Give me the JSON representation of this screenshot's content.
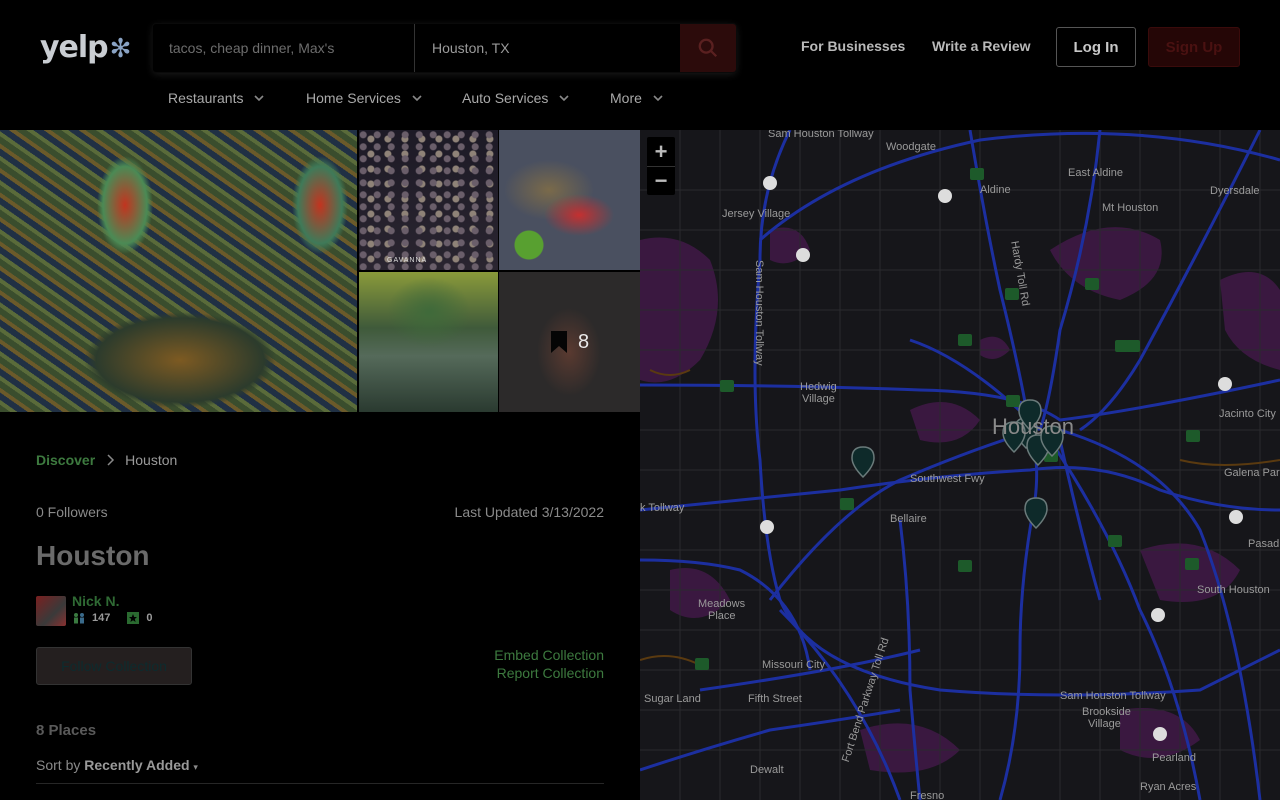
{
  "header": {
    "logo": "yelp",
    "search_find_placeholder": "tacos, cheap dinner, Max's",
    "search_near_value": "Houston, TX",
    "for_businesses": "For Businesses",
    "write_review": "Write a Review",
    "login": "Log In",
    "signup": "Sign Up",
    "nav": [
      {
        "label": "Restaurants"
      },
      {
        "label": "Home Services"
      },
      {
        "label": "Auto Services"
      },
      {
        "label": "More"
      }
    ]
  },
  "photos": {
    "crowd_caption": "GAVANNA",
    "more_count": "8"
  },
  "collection": {
    "breadcrumb_root": "Discover",
    "breadcrumb_current": "Houston",
    "followers": "0 Followers",
    "last_updated": "Last Updated 3/13/2022",
    "title": "Houston",
    "user_name": "Nick N.",
    "user_friends": "147",
    "user_reviews": "0",
    "follow_label": "Follow Collection",
    "embed_label": "Embed Collection",
    "report_label": "Report Collection",
    "places_count": "8 Places",
    "sort_prefix": "Sort by",
    "sort_value": "Recently Added"
  },
  "map": {
    "zoom_in": "+",
    "zoom_out": "−",
    "labels": {
      "woodgate": "Woodgate",
      "aldine": "Aldine",
      "east_aldine": "East Aldine",
      "dyersdale": "Dyersdale",
      "mt_houston": "Mt Houston",
      "jersey_village": "Jersey Village",
      "hardy_toll": "Hardy Toll Rd",
      "sam_houston_tollway": "Sam Houston Tollway",
      "hedwig": "Hedwig",
      "hedwig_village": "Village",
      "houston": "Houston",
      "jacinto": "Jacinto City",
      "galena": "Galena Park",
      "southwest_fwy": "Southwest Fwy",
      "bellaire": "Bellaire",
      "tollway": "k Tollway",
      "meadows": "Meadows",
      "meadows_place": "Place",
      "missouri_city": "Missouri City",
      "fort_bend": "Fort Bend Parkway Toll Rd",
      "sugar_land": "Sugar Land",
      "fifth_street": "Fifth Street",
      "sam_houston_south": "Sam Houston Tollway",
      "brookside": "Brookside",
      "brookside_village": "Village",
      "south_houston": "South Houston",
      "pasadena": "Pasad",
      "pearland": "Pearland",
      "dewalt": "Dewalt",
      "ryan_acres": "Ryan Acres",
      "fresno": "Fresno"
    }
  }
}
